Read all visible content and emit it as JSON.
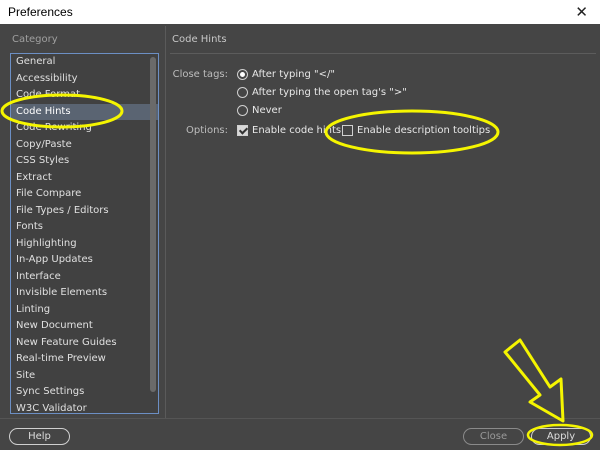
{
  "window": {
    "title": "Preferences",
    "close_glyph": "✕"
  },
  "sidebar": {
    "heading": "Category",
    "items": [
      {
        "label": "General"
      },
      {
        "label": "Accessibility"
      },
      {
        "label": "Code Format"
      },
      {
        "label": "Code Hints",
        "selected": true
      },
      {
        "label": "Code Rewriting"
      },
      {
        "label": "Copy/Paste"
      },
      {
        "label": "CSS Styles"
      },
      {
        "label": "Extract"
      },
      {
        "label": "File Compare"
      },
      {
        "label": "File Types / Editors"
      },
      {
        "label": "Fonts"
      },
      {
        "label": "Highlighting"
      },
      {
        "label": "In-App Updates"
      },
      {
        "label": "Interface"
      },
      {
        "label": "Invisible Elements"
      },
      {
        "label": "Linting"
      },
      {
        "label": "New Document"
      },
      {
        "label": "New Feature Guides"
      },
      {
        "label": "Real-time Preview"
      },
      {
        "label": "Site"
      },
      {
        "label": "Sync Settings"
      },
      {
        "label": "W3C Validator"
      }
    ]
  },
  "panel": {
    "title": "Code Hints",
    "close_tags": {
      "label": "Close tags:",
      "options": [
        {
          "label": "After typing \"</\"",
          "checked": true
        },
        {
          "label": "After typing the open tag's \">\"",
          "checked": false
        },
        {
          "label": "Never",
          "checked": false
        }
      ]
    },
    "options": {
      "label": "Options:",
      "enable_code_hints": {
        "label": "Enable code hints",
        "checked": true
      },
      "enable_description_tooltips": {
        "label": "Enable description tooltips",
        "checked": false
      }
    }
  },
  "footer": {
    "help_label": "Help",
    "close_label": "Close",
    "apply_label": "Apply"
  },
  "annotations": {
    "highlight_color": "#f5f500"
  }
}
